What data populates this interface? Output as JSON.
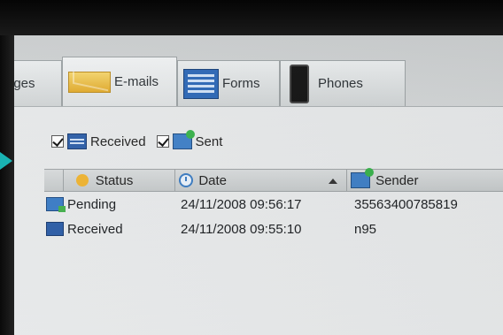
{
  "tabs": [
    {
      "label": "ages",
      "icon": "messages-icon"
    },
    {
      "label": "E-mails",
      "icon": "email-envelope-icon"
    },
    {
      "label": "Forms",
      "icon": "forms-icon"
    },
    {
      "label": "Phones",
      "icon": "phone-icon"
    }
  ],
  "filters": {
    "received": {
      "label": "Received",
      "checked": true
    },
    "sent": {
      "label": "Sent",
      "checked": true
    }
  },
  "table": {
    "columns": [
      "Status",
      "Date",
      "Sender"
    ],
    "sorted_by": "Date",
    "rows": [
      {
        "status": "Pending",
        "date": "24/11/2008 09:56:17",
        "sender": "35563400785819"
      },
      {
        "status": "Received",
        "date": "24/11/2008 09:55:10",
        "sender": "n95"
      }
    ]
  },
  "colors": {
    "accent_arrow": "#19b3b3",
    "icon_blue": "#2c5ea8",
    "icon_green": "#37b24a",
    "status_icon": "#f0b430"
  }
}
